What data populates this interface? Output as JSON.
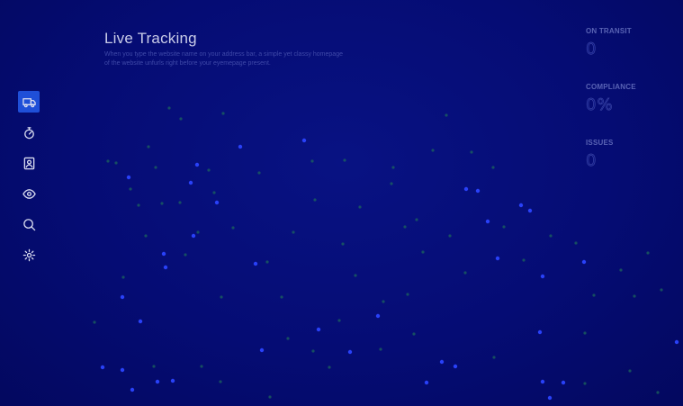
{
  "header": {
    "title": "Live Tracking",
    "subtitle": "When you type the website name on your address bar, a simple yet classy homepage of the website unfurls right before your eyemepage present."
  },
  "sidebar": {
    "items": [
      {
        "icon": "truck-icon",
        "active": true
      },
      {
        "icon": "stopwatch-icon",
        "active": false
      },
      {
        "icon": "contact-card-icon",
        "active": false
      },
      {
        "icon": "eye-icon",
        "active": false
      },
      {
        "icon": "search-icon",
        "active": false
      },
      {
        "icon": "gear-icon",
        "active": false
      }
    ]
  },
  "stats": [
    {
      "label": "ON TRANSIT",
      "value": "0"
    },
    {
      "label": "COMPLIANCE",
      "value": "0%"
    },
    {
      "label": "ISSUES",
      "value": "0"
    }
  ],
  "colors": {
    "background": "#040a6e",
    "accent": "#1f4fd8",
    "dot_blue": "#2b45ff",
    "dot_green": "#1e6b5a"
  }
}
